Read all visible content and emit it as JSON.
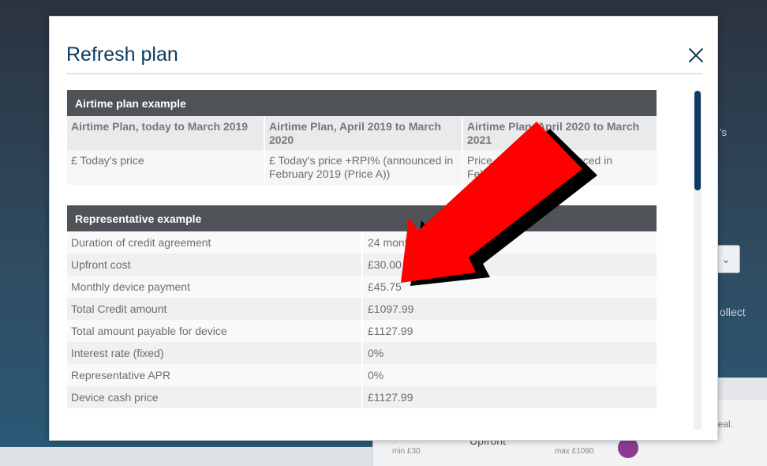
{
  "modal": {
    "title": "Refresh plan"
  },
  "airtime": {
    "section_title": "Airtime plan example",
    "headers": [
      "Airtime Plan, today to March 2019",
      "Airtime Plan, April 2019 to March 2020",
      "Airtime Plan, April 2020 to March 2021"
    ],
    "cells": [
      "£ Today's price",
      "£ Today's price +RPI% (announced in February 2019 (Price A))",
      "Price A +RPI% (announced in February 2020)"
    ]
  },
  "representative": {
    "section_title": "Representative example",
    "rows": [
      {
        "label": "Duration of credit agreement",
        "value": "24 months"
      },
      {
        "label": "Upfront cost",
        "value": "£30.00"
      },
      {
        "label": "Monthly device payment",
        "value": "£45.75"
      },
      {
        "label": "Total Credit amount",
        "value": "£1097.99"
      },
      {
        "label": "Total amount payable for device",
        "value": "£1127.99"
      },
      {
        "label": "Interest rate (fixed)",
        "value": "0%"
      },
      {
        "label": "Representative APR",
        "value": "0%"
      },
      {
        "label": "Device cash price",
        "value": "£1127.99"
      }
    ]
  },
  "background": {
    "side_text_1": "'s",
    "side_text_2": "ollect",
    "card_note": "a deal.",
    "card_min": "min £30",
    "card_upfront": "Upfront",
    "card_max": "max £1090",
    "select_chevron": "⌄"
  },
  "colors": {
    "brand_navy": "#0e3a5c",
    "section_header": "#4f5357",
    "annotation_arrow": "#ff0000"
  }
}
